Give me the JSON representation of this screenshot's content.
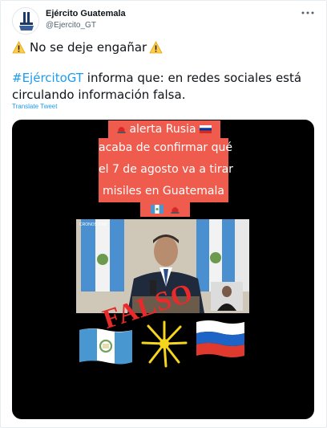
{
  "tweet": {
    "display_name": "Ejército Guatemala",
    "handle": "@Ejercito_GT",
    "more_icon": "ellipsis-icon",
    "line1": "No se deje engañar",
    "hashtag": "#EjércitoGT",
    "body_rest": " informa que: en redes sociales está circulando información falsa.",
    "translate_label": "Translate Tweet"
  },
  "media": {
    "alert_lines": [
      "alerta Rusia",
      "acaba de confirmar qué",
      "el 7 de agosto va a tirar",
      "misiles en Guatemala"
    ],
    "stamp_text": "FALSO",
    "channel_text": "CRONOS TIME"
  },
  "colors": {
    "link": "#1d9bf0",
    "alert_red": "#ef5b4c",
    "stamp_red": "#e82a2a",
    "media_bg": "#000000"
  }
}
